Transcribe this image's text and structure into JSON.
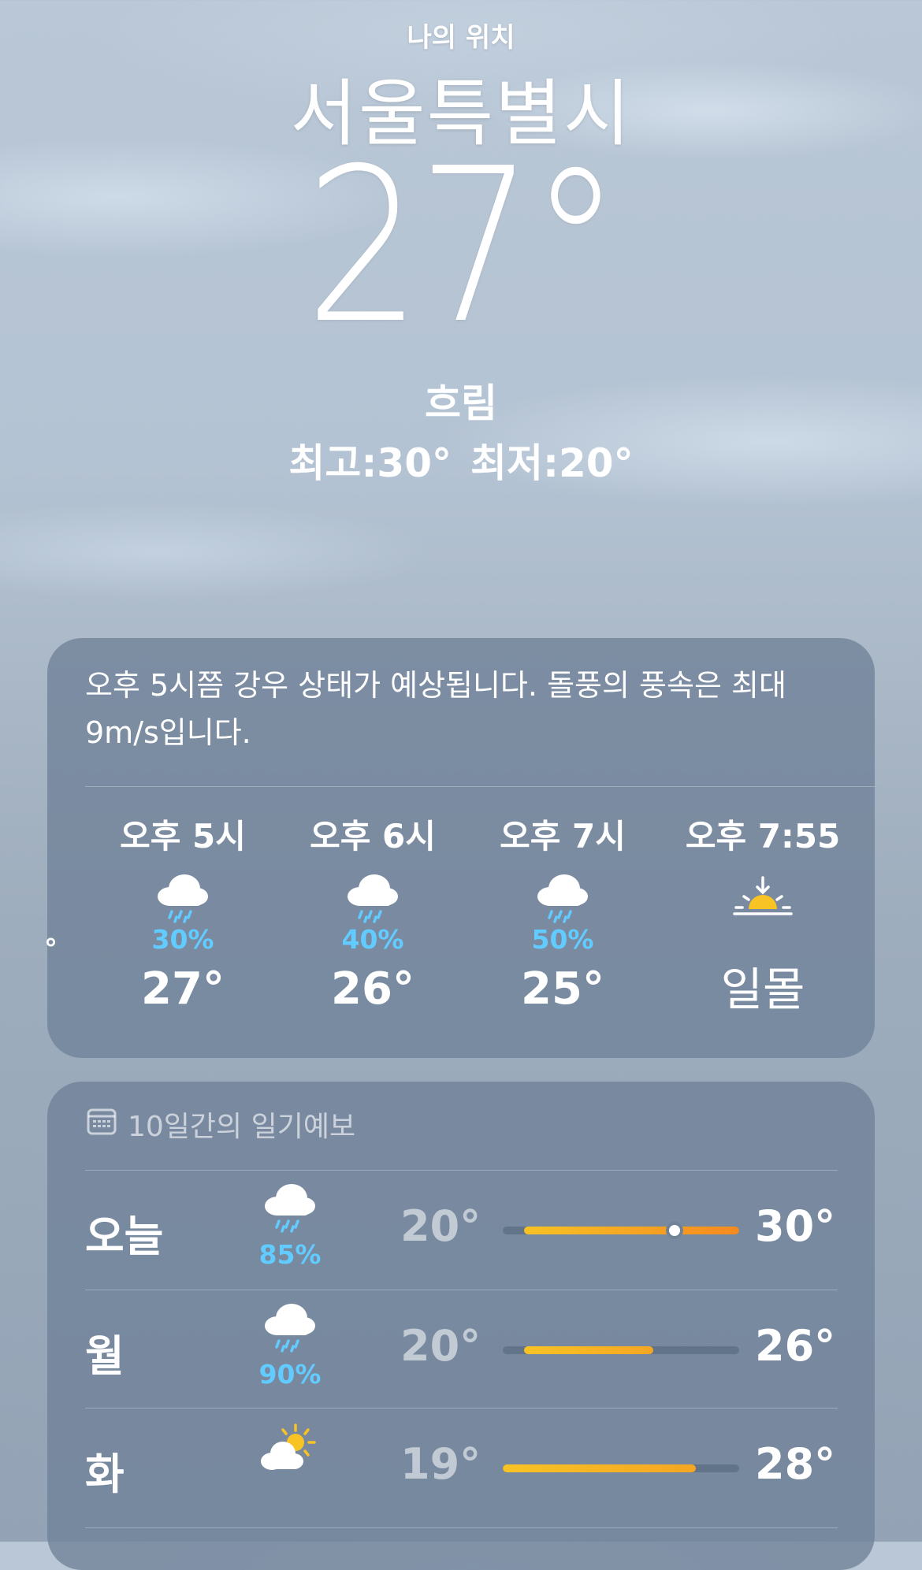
{
  "header": {
    "my_location": "나의 위치",
    "city": "서울특별시",
    "temperature": "27°",
    "condition": "흐림",
    "high": "최고:30°",
    "low": "최저:20°"
  },
  "hourly": {
    "summary": "오후 5시쯤 강우 상태가 예상됩니다. 돌풍의 풍속은 최대 9m/s입니다.",
    "edge_glyph": "°",
    "items": [
      {
        "time": "오후 5시",
        "icon": "cloud-rain-icon",
        "prob": "30%",
        "value": "27°"
      },
      {
        "time": "오후 6시",
        "icon": "cloud-rain-icon",
        "prob": "40%",
        "value": "26°"
      },
      {
        "time": "오후 7시",
        "icon": "cloud-rain-icon",
        "prob": "50%",
        "value": "25°"
      },
      {
        "time": "오후 7:55",
        "icon": "sunset-icon",
        "prob": "",
        "value": "일몰"
      }
    ]
  },
  "daily": {
    "title": "10일간의 일기예보",
    "title_icon": "calendar-icon",
    "range_min": 19,
    "range_max": 30,
    "days": [
      {
        "name": "오늘",
        "icon": "cloud-rain-icon",
        "prob": "85%",
        "low": "20°",
        "high": "30°",
        "low_value": 20,
        "high_value": 30,
        "current_value": 27
      },
      {
        "name": "월",
        "icon": "cloud-rain-icon",
        "prob": "90%",
        "low": "20°",
        "high": "26°",
        "low_value": 20,
        "high_value": 26
      },
      {
        "name": "화",
        "icon": "partly-sunny-icon",
        "prob": "",
        "low": "19°",
        "high": "28°",
        "low_value": 19,
        "high_value": 28
      }
    ]
  },
  "colors": {
    "precip": "#62cbff",
    "bar_yellow": "#f7c325",
    "bar_orange": "#f58a1f",
    "card": "#708298"
  }
}
